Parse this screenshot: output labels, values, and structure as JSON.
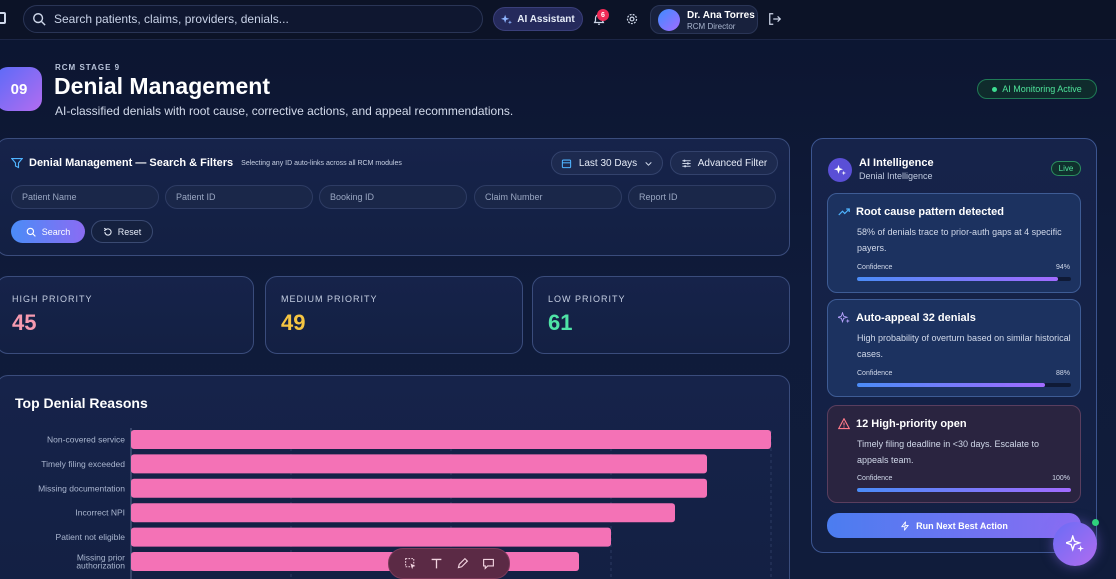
{
  "topbar": {
    "search_placeholder": "Search patients, claims, providers, denials...",
    "ai_assistant_label": "AI Assistant",
    "notification_count": "6",
    "user_name": "Dr. Ana Torres",
    "user_role": "RCM Director"
  },
  "header": {
    "stage_number": "09",
    "stage_label": "RCM STAGE 9",
    "title": "Denial Management",
    "subtitle": "AI-classified denials with root cause, corrective actions, and appeal recommendations.",
    "monitor_badge": "AI Monitoring Active"
  },
  "filters": {
    "title": "Denial Management — Search & Filters",
    "hint": "Selecting any ID auto-links across all RCM modules",
    "range_label": "Last 30 Days",
    "advanced_label": "Advanced Filter",
    "fields": {
      "patient_name": "Patient Name",
      "patient_id": "Patient ID",
      "booking_id": "Booking ID",
      "claim_number": "Claim Number",
      "report_id": "Report ID"
    },
    "search_label": "Search",
    "reset_label": "Reset"
  },
  "stats": {
    "high": {
      "label": "HIGH PRIORITY",
      "value": "45",
      "color": "#f59ab0"
    },
    "medium": {
      "label": "MEDIUM PRIORITY",
      "value": "49",
      "color": "#f5c542"
    },
    "low": {
      "label": "LOW PRIORITY",
      "value": "61",
      "color": "#4fe3a6"
    }
  },
  "chart_title": "Top Denial Reasons",
  "chart_data": {
    "type": "bar",
    "orientation": "horizontal",
    "title": "Top Denial Reasons",
    "categories": [
      "Non-covered service",
      "Timely filing exceeded",
      "Missing documentation",
      "Incorrect NPI",
      "Patient not eligible",
      "Missing prior authorization"
    ],
    "values": [
      40,
      36,
      36,
      34,
      30,
      28
    ],
    "xlim": [
      0,
      40
    ],
    "color": "#f472b6",
    "grid": true
  },
  "ai_panel": {
    "title": "AI Intelligence",
    "subtitle": "Denial Intelligence",
    "live_label": "Live",
    "insights": [
      {
        "title": "Root cause pattern detected",
        "body": "58% of denials trace to prior-auth gaps at 4 specific payers.",
        "confidence_label": "Confidence",
        "confidence": "94%",
        "confidence_value": 94
      },
      {
        "title": "Auto-appeal 32 denials",
        "body": "High probability of overturn based on similar historical cases.",
        "confidence_label": "Confidence",
        "confidence": "88%",
        "confidence_value": 88
      },
      {
        "title": "12 High-priority open",
        "body": "Timely filing deadline in <30 days. Escalate to appeals team.",
        "confidence_label": "Confidence",
        "confidence": "100%",
        "confidence_value": 100
      }
    ],
    "action_label": "Run Next Best Action"
  },
  "icons": [
    "sidebar-toggle-icon",
    "search-icon",
    "sparkles-icon",
    "bell-icon",
    "gear-icon",
    "logout-icon",
    "filter-icon",
    "calendar-icon",
    "chevron-down-icon",
    "sliders-icon",
    "reset-icon",
    "trend-icon",
    "alert-icon",
    "zap-icon",
    "select-icon",
    "text-icon",
    "pen-icon",
    "comment-icon"
  ]
}
